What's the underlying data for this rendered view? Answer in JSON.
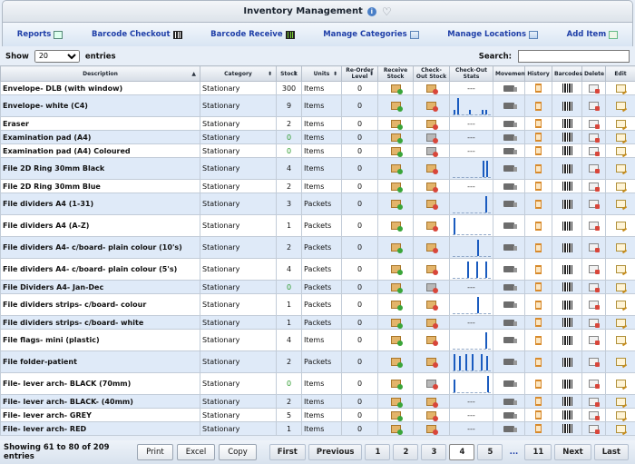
{
  "app": {
    "title": "Inventory Management"
  },
  "nav": [
    {
      "label": "Reports",
      "icon": "spreadsheet-icon"
    },
    {
      "label": "Barcode Checkout",
      "icon": "barcode-icon"
    },
    {
      "label": "Barcode Receive",
      "icon": "barcode-receive-icon"
    },
    {
      "label": "Manage Categories",
      "icon": "grid-icon"
    },
    {
      "label": "Manage Locations",
      "icon": "grid-icon"
    },
    {
      "label": "Add Item",
      "icon": "add-item-icon"
    }
  ],
  "controls": {
    "show_label": "Show",
    "entries_value": "20",
    "entries_label": "entries",
    "search_label": "Search:",
    "search_value": ""
  },
  "columns": [
    "Description",
    "Category",
    "Stock",
    "Units",
    "Re-Order Level",
    "Receive Stock",
    "Check-Out Stock",
    "Check-Out Stats",
    "Movement",
    "History",
    "Barcodes",
    "Delete",
    "Edit"
  ],
  "rows": [
    {
      "description": "Envelope- DLB (with window)",
      "category": "Stationary",
      "stock": "300",
      "units": "Items",
      "reorder": "0",
      "stats": [],
      "out_disabled": false
    },
    {
      "description": "Envelope- white (C4)",
      "category": "Stationary",
      "stock": "9",
      "units": "Items",
      "reorder": "0",
      "stats": [
        0.3,
        1.0,
        0,
        0,
        0.25,
        0,
        0,
        0.3,
        0.3
      ],
      "out_disabled": false
    },
    {
      "description": "Eraser",
      "category": "Stationary",
      "stock": "2",
      "units": "Items",
      "reorder": "0",
      "stats": [],
      "out_disabled": false
    },
    {
      "description": "Examination pad (A4)",
      "category": "Stationary",
      "stock": "0",
      "units": "Items",
      "reorder": "0",
      "stats": [],
      "out_disabled": true
    },
    {
      "description": "Examination pad (A4) Coloured",
      "category": "Stationary",
      "stock": "0",
      "units": "Items",
      "reorder": "0",
      "stats": [],
      "out_disabled": true
    },
    {
      "description": "File 2D Ring 30mm Black",
      "category": "Stationary",
      "stock": "4",
      "units": "Items",
      "reorder": "0",
      "stats": [
        0,
        0,
        0,
        0,
        0,
        0,
        0,
        0,
        1.0,
        1.0
      ],
      "out_disabled": false
    },
    {
      "description": "File 2D Ring 30mm Blue",
      "category": "Stationary",
      "stock": "2",
      "units": "Items",
      "reorder": "0",
      "stats": [],
      "out_disabled": false
    },
    {
      "description": "File dividers A4 (1-31)",
      "category": "Stationary",
      "stock": "3",
      "units": "Packets",
      "reorder": "0",
      "stats": [
        0,
        0,
        0,
        0,
        0,
        0,
        0,
        0,
        1.0
      ],
      "out_disabled": false
    },
    {
      "description": "File dividers A4 (A-Z)",
      "category": "Stationary",
      "stock": "1",
      "units": "Packets",
      "reorder": "0",
      "stats": [
        1.0
      ],
      "out_disabled": false
    },
    {
      "description": "File dividers A4- c/board- plain colour (10's)",
      "category": "Stationary",
      "stock": "2",
      "units": "Packets",
      "reorder": "0",
      "stats": [
        0,
        0,
        1.0
      ],
      "out_disabled": false
    },
    {
      "description": "File dividers A4- c/board- plain colour (5's)",
      "category": "Stationary",
      "stock": "4",
      "units": "Packets",
      "reorder": "0",
      "stats": [
        0,
        0,
        0,
        1.0,
        0,
        1.0,
        0,
        1.0
      ],
      "out_disabled": false
    },
    {
      "description": "File Dividers A4- Jan-Dec",
      "category": "Stationary",
      "stock": "0",
      "units": "Packets",
      "reorder": "0",
      "stats": [],
      "out_disabled": true
    },
    {
      "description": "File dividers strips- c/board- colour",
      "category": "Stationary",
      "stock": "1",
      "units": "Packets",
      "reorder": "0",
      "stats": [
        0,
        0,
        1.0
      ],
      "out_disabled": false
    },
    {
      "description": "File dividers strips- c/board- white",
      "category": "Stationary",
      "stock": "1",
      "units": "Packets",
      "reorder": "0",
      "stats": [],
      "out_disabled": false
    },
    {
      "description": "File flags- mini (plastic)",
      "category": "Stationary",
      "stock": "4",
      "units": "Items",
      "reorder": "0",
      "stats": [
        0,
        0,
        0,
        0,
        0,
        0,
        0,
        1.0
      ],
      "out_disabled": false
    },
    {
      "description": "File folder-patient",
      "category": "Stationary",
      "stock": "2",
      "units": "Packets",
      "reorder": "0",
      "stats": [
        1.0,
        0,
        0.9,
        0,
        1.0,
        0,
        1.0,
        0,
        0,
        1.0,
        0,
        0.9
      ],
      "out_disabled": false
    },
    {
      "description": "File- lever arch- BLACK (70mm)",
      "category": "Stationary",
      "stock": "0",
      "units": "Items",
      "reorder": "0",
      "stats": [
        0.8,
        0,
        0,
        0,
        0,
        0,
        0,
        0,
        0,
        0,
        0,
        0,
        0,
        0,
        0,
        1.0
      ],
      "out_disabled": true
    },
    {
      "description": "File- lever arch- BLACK- (40mm)",
      "category": "Stationary",
      "stock": "2",
      "units": "Items",
      "reorder": "0",
      "stats": [],
      "out_disabled": false
    },
    {
      "description": "File- lever arch- GREY",
      "category": "Stationary",
      "stock": "5",
      "units": "Items",
      "reorder": "0",
      "stats": [],
      "out_disabled": false
    },
    {
      "description": "File- lever arch- RED",
      "category": "Stationary",
      "stock": "1",
      "units": "Items",
      "reorder": "0",
      "stats": [],
      "out_disabled": false
    }
  ],
  "footer": {
    "info": "Showing 61 to 80 of 209 entries",
    "buttons": [
      "Print",
      "Excel",
      "Copy"
    ],
    "pager": [
      "First",
      "Previous",
      "1",
      "2",
      "3",
      "4",
      "5",
      "...",
      "11",
      "Next",
      "Last"
    ],
    "current_page": "4"
  },
  "colors": {
    "accent": "#1f3fa8",
    "row_alt": "#dfeaf8",
    "spark": "#1a5bbf",
    "zero_stock": "#2b9a2b"
  }
}
